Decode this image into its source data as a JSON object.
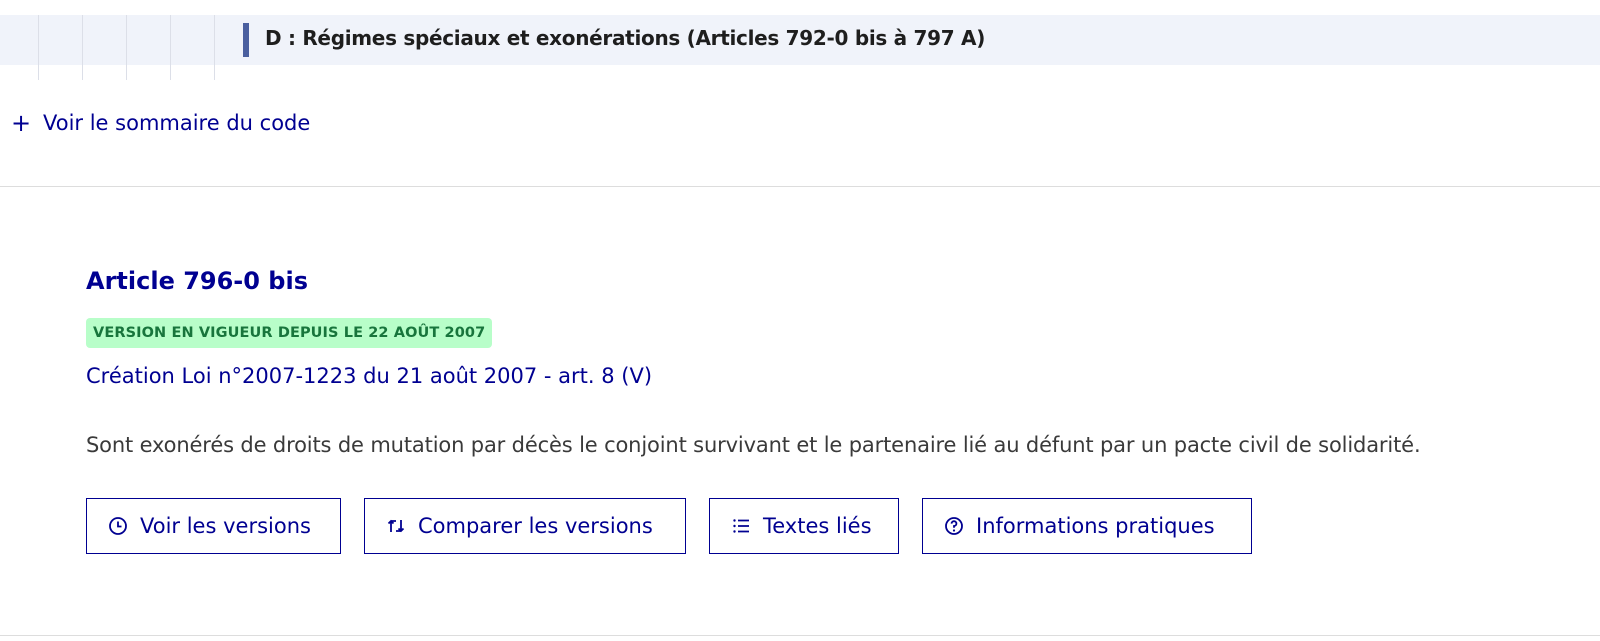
{
  "breadcrumb_section": {
    "title": "D : Régimes spéciaux et exonérations (Articles 792-0 bis à 797 A)"
  },
  "summary": {
    "icon": "+",
    "label": "Voir le sommaire du code"
  },
  "article": {
    "title": "Article 796-0 bis",
    "badge": "VERSION EN VIGUEUR DEPUIS LE 22 AOÛT 2007",
    "creation": "Création Loi n°2007-1223 du 21 août 2007 - art. 8 (V)",
    "text": "Sont exonérés de droits de mutation par décès le conjoint survivant et le partenaire lié au défunt par un pacte civil de solidarité."
  },
  "actions": {
    "versions": {
      "label": "Voir les versions",
      "icon": "clock-icon"
    },
    "compare": {
      "label": "Comparer les versions",
      "icon": "compare-arrows-icon"
    },
    "related": {
      "label": "Textes liés",
      "icon": "list-icon"
    },
    "info": {
      "label": "Informations pratiques",
      "icon": "question-circle-icon"
    }
  },
  "colors": {
    "primary": "#000091",
    "badge_bg": "#b8fec9",
    "badge_text": "#18753c",
    "section_bg": "#f0f3fa",
    "section_accent": "#4a5f9f"
  }
}
